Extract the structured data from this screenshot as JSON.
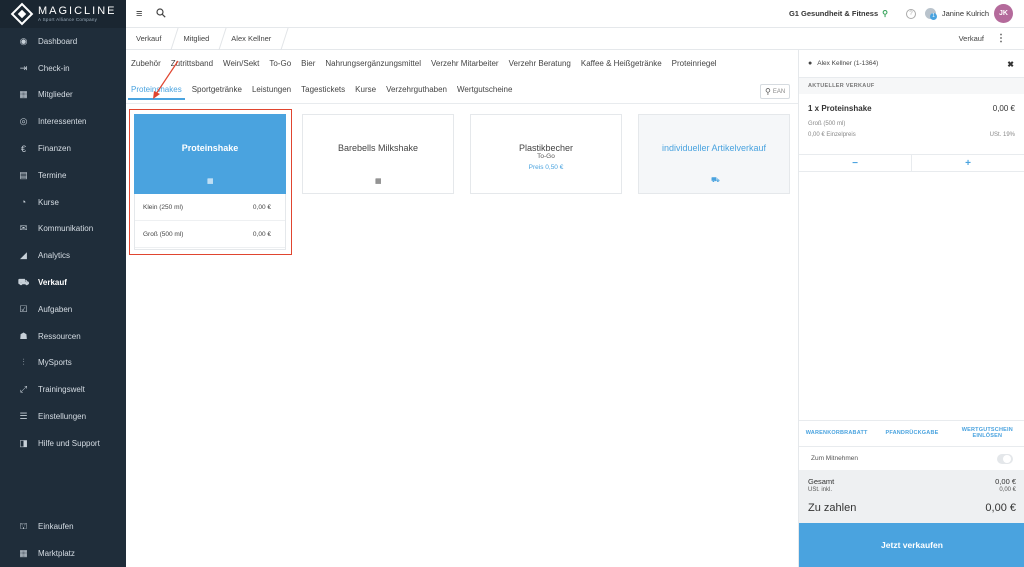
{
  "brand": {
    "name": "MAGICLINE",
    "tagline": "A Sport Alliance Company"
  },
  "sidebar": {
    "items": [
      {
        "label": "Dashboard",
        "icon": "dashboard-icon",
        "glyph": "◉"
      },
      {
        "label": "Check-in",
        "icon": "checkin-icon",
        "glyph": "⇥"
      },
      {
        "label": "Mitglieder",
        "icon": "members-icon",
        "glyph": "▦"
      },
      {
        "label": "Interessenten",
        "icon": "prospects-icon",
        "glyph": "◎"
      },
      {
        "label": "Finanzen",
        "icon": "finance-icon",
        "glyph": "€"
      },
      {
        "label": "Termine",
        "icon": "calendar-icon",
        "glyph": "▤"
      },
      {
        "label": "Kurse",
        "icon": "courses-icon",
        "glyph": "◔"
      },
      {
        "label": "Kommunikation",
        "icon": "communication-icon",
        "glyph": "✉"
      },
      {
        "label": "Analytics",
        "icon": "analytics-icon",
        "glyph": "◢"
      },
      {
        "label": "Verkauf",
        "icon": "cart-icon",
        "glyph": "⛟",
        "active": true
      },
      {
        "label": "Aufgaben",
        "icon": "tasks-icon",
        "glyph": "☑"
      },
      {
        "label": "Ressourcen",
        "icon": "resources-icon",
        "glyph": "☗"
      },
      {
        "label": "MySports",
        "icon": "mysports-icon",
        "glyph": "⫶"
      },
      {
        "label": "Trainingswelt",
        "icon": "training-icon",
        "glyph": "⤢"
      },
      {
        "label": "Einstellungen",
        "icon": "settings-icon",
        "glyph": "☰"
      },
      {
        "label": "Hilfe und Support",
        "icon": "help-icon",
        "glyph": "◨"
      }
    ],
    "bottom": [
      {
        "label": "Einkaufen",
        "icon": "shop-icon",
        "glyph": "⛫"
      },
      {
        "label": "Marktplatz",
        "icon": "marketplace-icon",
        "glyph": "▦"
      }
    ]
  },
  "topbar": {
    "studio": "G1 Gesundheit & Fitness",
    "help": "?",
    "notif_count": "1",
    "user": "Janine Kulrich",
    "initials": "JK"
  },
  "breadcrumb": {
    "items": [
      "Verkauf",
      "Mitglied",
      "Alex Kellner"
    ],
    "right_label": "Verkauf"
  },
  "categories": {
    "row1": [
      "Zubehör",
      "Zutrittsband",
      "Wein/Sekt",
      "To-Go",
      "Bier",
      "Nahrungsergänzungsmittel",
      "Verzehr Mitarbeiter",
      "Verzehr Beratung",
      "Kaffee & Heißgetränke",
      "Proteinriegel"
    ],
    "row2": [
      "Proteinshakes",
      "Sportgetränke",
      "Leistungen",
      "Tagestickets",
      "Kurse",
      "Verzehrguthaben",
      "Wertgutscheine"
    ],
    "active": "Proteinshakes",
    "ean_placeholder": "EAN"
  },
  "products": [
    {
      "name": "Proteinshake",
      "selected": true
    },
    {
      "name": "Barebells Milkshake"
    },
    {
      "name": "Plastikbecher",
      "sub": "To-Go",
      "price": "Preis 0,50 €"
    },
    {
      "name": "individueller Artikelverkauf",
      "custom": true
    }
  ],
  "variants": [
    {
      "label": "Klein (250 ml)",
      "price": "0,00 €"
    },
    {
      "label": "Groß (500 ml)",
      "price": "0,00 €"
    }
  ],
  "cart": {
    "customer": "Alex Kellner (1-1364)",
    "section": "AKTUELLER VERKAUF",
    "item": {
      "name": "1 x Proteinshake",
      "price": "0,00 €",
      "variant": "Groß (500 ml)",
      "unit": "0,00 € Einzelpreis",
      "tax": "USt. 19%"
    },
    "minus": "−",
    "plus": "+",
    "actions": [
      "WARENKORBRABATT",
      "PFANDRÜCKGABE",
      "WERTGUTSCHEIN EINLÖSEN"
    ],
    "takeaway": "Zum Mitnehmen",
    "total_label": "Gesamt",
    "total": "0,00 €",
    "tax_label": "USt. inkl.",
    "tax": "0,00 €",
    "due_label": "Zu zahlen",
    "due": "0,00 €",
    "sell": "Jetzt verkaufen"
  },
  "colors": {
    "accent": "#4aa3df",
    "sidebar": "#1f2d3a",
    "highlight": "#e0452f"
  }
}
